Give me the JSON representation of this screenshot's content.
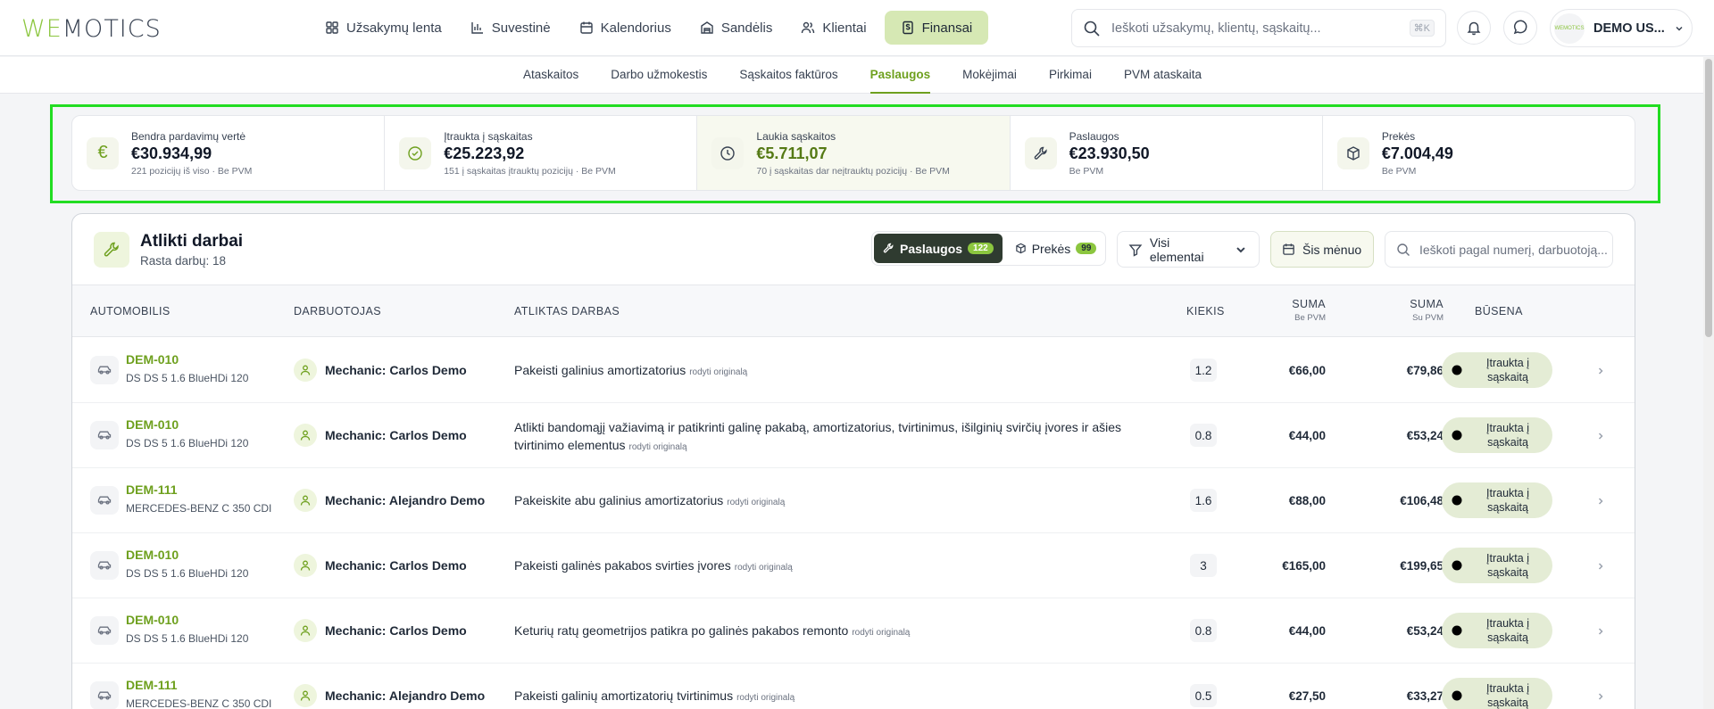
{
  "logo": {
    "brand_a": "WE",
    "brand_b": "MOTICS"
  },
  "nav": [
    {
      "label": "Užsakymų lenta",
      "icon": "grid-icon"
    },
    {
      "label": "Suvestinė",
      "icon": "bar-chart-icon"
    },
    {
      "label": "Kalendorius",
      "icon": "calendar-icon"
    },
    {
      "label": "Sandėlis",
      "icon": "warehouse-icon"
    },
    {
      "label": "Klientai",
      "icon": "users-icon"
    },
    {
      "label": "Finansai",
      "icon": "dollar-doc-icon"
    }
  ],
  "search": {
    "placeholder": "Ieškoti užsakymų, klientų, sąskaitų...",
    "shortcut": "⌘K"
  },
  "user": {
    "name": "DEMO US...",
    "avatar_text": "WEMOTICS"
  },
  "subnav": [
    "Ataskaitos",
    "Darbo užmokestis",
    "Sąskaitos faktūros",
    "Paslaugos",
    "Mokėjimai",
    "Pirkimai",
    "PVM ataskaita"
  ],
  "stats": [
    {
      "label": "Bendra pardavimų vertė",
      "value": "€30.934,99",
      "sub": "221 pozicijų iš viso · Be PVM",
      "icon": "euro-icon"
    },
    {
      "label": "Įtraukta į sąskaitas",
      "value": "€25.223,92",
      "sub": "151 į sąskaitas įtrauktų pozicijų · Be PVM",
      "icon": "check-circle-icon"
    },
    {
      "label": "Laukia sąskaitos",
      "value": "€5.711,07",
      "sub": "70 į sąskaitas dar neįtrauktų pozicijų · Be PVM",
      "icon": "clock-icon"
    },
    {
      "label": "Paslaugos",
      "value": "€23.930,50",
      "sub": "Be PVM",
      "icon": "wrench-icon"
    },
    {
      "label": "Prekės",
      "value": "€7.004,49",
      "sub": "Be PVM",
      "icon": "box-icon"
    }
  ],
  "panel": {
    "title": "Atlikti darbai",
    "count": "Rasta darbų: 18",
    "seg_services": "Paslaugos",
    "seg_services_count": "122",
    "seg_goods": "Prekės",
    "seg_goods_count": "99",
    "filter": "Visi elementai",
    "period": "Šis mėnuo",
    "search_placeholder": "Ieškoti pagal numerį, darbuotoją..."
  },
  "columns": {
    "car": "AUTOMOBILIS",
    "employee": "DARBUOTOJAS",
    "work": "ATLIKTAS DARBAS",
    "qty": "KIEKIS",
    "sum": "SUMA",
    "sum_sub_net": "Be PVM",
    "sum_sub_gross": "Su PVM",
    "status": "BŪSENA"
  },
  "rows": [
    {
      "plate": "DEM-010",
      "model": "DS DS 5 1.6 BlueHDi 120",
      "mechanic": "Mechanic: Carlos Demo",
      "work": "Pakeisti galinius amortizatorius",
      "orig": "rodyti originalą",
      "qty": "1.2",
      "net": "€66,00",
      "gross": "€79,86",
      "status": "Įtraukta į sąskaitą"
    },
    {
      "plate": "DEM-010",
      "model": "DS DS 5 1.6 BlueHDi 120",
      "mechanic": "Mechanic: Carlos Demo",
      "work": "Atlikti bandomąjį važiavimą ir patikrinti galinę pakabą, amortizatorius, tvirtinimus, išilginių svirčių įvores ir ašies tvirtinimo elementus",
      "orig": "rodyti originalą",
      "qty": "0.8",
      "net": "€44,00",
      "gross": "€53,24",
      "status": "Įtraukta į sąskaitą"
    },
    {
      "plate": "DEM-111",
      "model": "MERCEDES-BENZ C 350 CDI",
      "mechanic": "Mechanic: Alejandro Demo",
      "work": "Pakeiskite abu galinius amortizatorius",
      "orig": "rodyti originalą",
      "qty": "1.6",
      "net": "€88,00",
      "gross": "€106,48",
      "status": "Įtraukta į sąskaitą"
    },
    {
      "plate": "DEM-010",
      "model": "DS DS 5 1.6 BlueHDi 120",
      "mechanic": "Mechanic: Carlos Demo",
      "work": "Pakeisti galinės pakabos svirties įvores",
      "orig": "rodyti originalą",
      "qty": "3",
      "net": "€165,00",
      "gross": "€199,65",
      "status": "Įtraukta į sąskaitą"
    },
    {
      "plate": "DEM-010",
      "model": "DS DS 5 1.6 BlueHDi 120",
      "mechanic": "Mechanic: Carlos Demo",
      "work": "Keturių ratų geometrijos patikra po galinės pakabos remonto",
      "orig": "rodyti originalą",
      "qty": "0.8",
      "net": "€44,00",
      "gross": "€53,24",
      "status": "Įtraukta į sąskaitą"
    },
    {
      "plate": "DEM-111",
      "model": "MERCEDES-BENZ C 350 CDI",
      "mechanic": "Mechanic: Alejandro Demo",
      "work": "Pakeisti galinių amortizatorių tvirtinimus",
      "orig": "rodyti originalą",
      "qty": "0.5",
      "net": "€27,50",
      "gross": "€33,27",
      "status": "Įtraukta į sąskaitą"
    }
  ],
  "colors": {
    "accent": "#6ea01e",
    "brand_green": "#8cc63f",
    "highlight_outline": "#22dd22"
  }
}
